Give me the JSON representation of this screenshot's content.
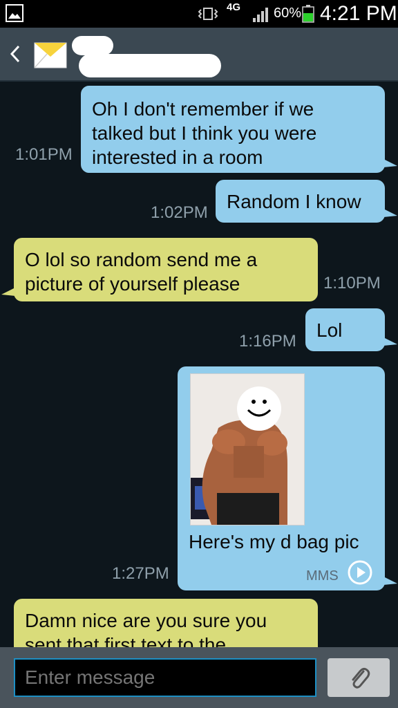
{
  "status_bar": {
    "network": "4G",
    "battery": "60%",
    "time": "4:21 PM",
    "icons": [
      "gallery-icon",
      "vibrate-icon",
      "signal-icon",
      "battery-icon"
    ]
  },
  "header": {
    "icons": [
      "back-icon",
      "envelope-icon"
    ]
  },
  "messages": [
    {
      "direction": "outgoing",
      "text": [
        "Oh I don't remember if we",
        "talked but I think you were",
        "interested in a room"
      ],
      "time": "1:01PM"
    },
    {
      "direction": "outgoing",
      "text": "Random I know",
      "time": "1:02PM"
    },
    {
      "direction": "incoming",
      "text": [
        "O lol so random send me a",
        "picture of yourself please"
      ],
      "time": "1:10PM"
    },
    {
      "direction": "outgoing",
      "text": "Lol",
      "time": "1:16PM"
    },
    {
      "direction": "outgoing",
      "type": "mms",
      "text": "Here's my d bag pic",
      "badge": "MMS",
      "time": "1:27PM"
    },
    {
      "direction": "incoming",
      "text": [
        "Damn nice are you sure you",
        "sent that first text to the"
      ]
    }
  ],
  "composer": {
    "placeholder": "Enter message",
    "attach_icon": "paperclip-icon"
  },
  "colors": {
    "outgoing_bubble": "#92cdec",
    "incoming_bubble": "#d9dc7a",
    "background": "#0d161c",
    "input_border": "#1d8fc4"
  }
}
